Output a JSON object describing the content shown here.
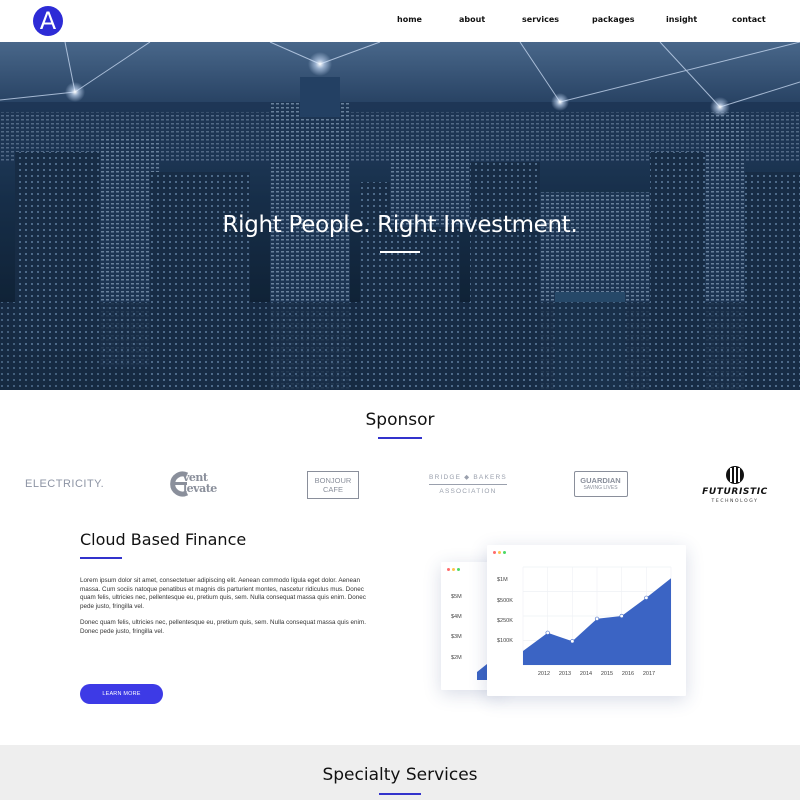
{
  "brand": {
    "logo_letter": "A"
  },
  "nav": {
    "items": [
      {
        "label": "home"
      },
      {
        "label": "about"
      },
      {
        "label": "services"
      },
      {
        "label": "packages"
      },
      {
        "label": "insight"
      },
      {
        "label": "contact"
      }
    ]
  },
  "hero": {
    "title": "Right People. Right Investment."
  },
  "sponsor": {
    "title": "Sponsor",
    "logos": {
      "electricity": "ELECTRICITY.",
      "event_elevate_1": "vent",
      "event_elevate_2": "levate",
      "bonjour_1": "BONJOUR",
      "bonjour_2": "CAFE",
      "bridge_1": "BRIDGE ◆ BAKERS",
      "bridge_2": "ASSOCIATION",
      "guardian_1": "GUARDIAN",
      "guardian_2": "SAVING LIVES",
      "futuristic_1": "FUTURISTIC",
      "futuristic_2": "TECHNOLOGY"
    }
  },
  "cloud": {
    "title": "Cloud Based Finance",
    "paragraph_1": "Lorem ipsum dolor sit amet, consectetuer adipiscing elit. Aenean commodo ligula eget dolor. Aenean massa. Cum sociis natoque penatibus et magnis dis parturient montes, nascetur ridiculus mus. Donec quam felis, ultricies nec, pellentesque eu, pretium quis, sem. Nulla consequat massa quis enim. Donec pede justo, fringilla vel.",
    "paragraph_2": "Donec quam felis, ultricies nec, pellentesque eu, pretium quis, sem. Nulla consequat massa quis enim. Donec pede justo, fringilla vel.",
    "button_label": "LEARN MORE"
  },
  "chart_data": {
    "type": "area",
    "x": [
      "2012",
      "2013",
      "2014",
      "2015",
      "2016",
      "2017"
    ],
    "values": [
      100,
      230,
      170,
      330,
      350,
      480,
      620
    ],
    "y_ticks": [
      "$1M",
      "$500K",
      "$250K",
      "$100K"
    ],
    "back_card_y_ticks": [
      "$5M",
      "$4M",
      "$3M",
      "$2M"
    ],
    "color": "#3b64c4"
  },
  "specialty": {
    "title": "Specialty Services"
  },
  "colors": {
    "accent": "#3333cc",
    "button": "#3d3ae6",
    "logo_bg": "#2d2bd6"
  }
}
